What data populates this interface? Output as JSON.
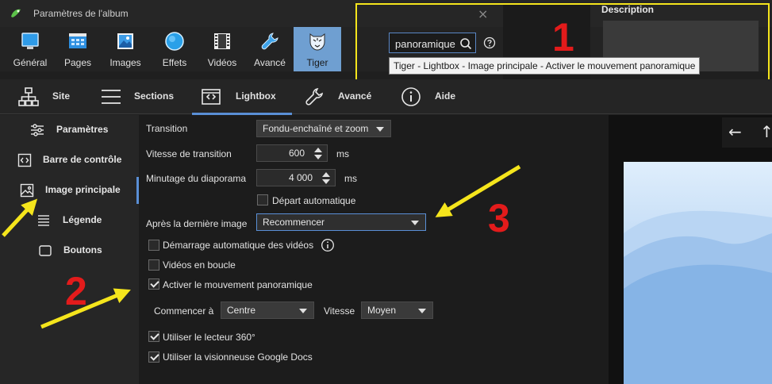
{
  "window": {
    "title": "Paramètres de l'album",
    "close_glyph": "×"
  },
  "toolbar": [
    {
      "label": "Général",
      "icon": "monitor-icon"
    },
    {
      "label": "Pages",
      "icon": "grid-icon"
    },
    {
      "label": "Images",
      "icon": "image-icon"
    },
    {
      "label": "Effets",
      "icon": "effects-icon"
    },
    {
      "label": "Vidéos",
      "icon": "film-icon"
    },
    {
      "label": "Avancé",
      "icon": "wrench-icon"
    },
    {
      "label": "Tiger",
      "icon": "tiger-icon",
      "active": true
    }
  ],
  "search": {
    "value": "panoramique",
    "tooltip": "Tiger - Lightbox - Image principale - Activer le mouvement panoramique"
  },
  "description": {
    "label": "Description"
  },
  "tabs": [
    {
      "label": "Site",
      "icon": "sitemap-icon"
    },
    {
      "label": "Sections",
      "icon": "lines-icon"
    },
    {
      "label": "Lightbox",
      "icon": "lightbox-icon",
      "active": true
    },
    {
      "label": "Avancé",
      "icon": "wrench-icon"
    },
    {
      "label": "Aide",
      "icon": "info-icon"
    }
  ],
  "nav": [
    {
      "label": "Paramètres",
      "icon": "sliders-icon"
    },
    {
      "label": "Barre de contrôle",
      "icon": "code-icon"
    },
    {
      "label": "Image principale",
      "icon": "image-icon",
      "active": true
    },
    {
      "label": "Légende",
      "icon": "lines-icon"
    },
    {
      "label": "Boutons",
      "icon": "button-icon"
    }
  ],
  "settings": {
    "transition_label": "Transition",
    "transition_value": "Fondu-enchaîné et zoom",
    "speed_label": "Vitesse de transition",
    "speed_value": "600",
    "speed_unit": "ms",
    "timer_label": "Minutage du diaporama",
    "timer_value": "4 000",
    "timer_unit": "ms",
    "autostart_label": "Départ automatique",
    "autostart_checked": false,
    "after_label": "Après la dernière image",
    "after_value": "Recommencer",
    "auto_video_label": "Démarrage automatique des vidéos",
    "auto_video_checked": false,
    "loop_label": "Vidéos en boucle",
    "loop_checked": false,
    "pan_label": "Activer le mouvement panoramique",
    "pan_checked": true,
    "start_label": "Commencer à",
    "start_value": "Centre",
    "pan_speed_label": "Vitesse",
    "pan_speed_value": "Moyen",
    "reader360_label": "Utiliser le lecteur 360°",
    "reader360_checked": true,
    "gdocs_label": "Utiliser la visionneuse Google Docs",
    "gdocs_checked": true
  },
  "preview": {
    "back_glyph": "←",
    "up_glyph": "↑"
  },
  "annotations": {
    "n1": "1",
    "n2": "2",
    "n3": "3",
    "highlight_color": "#f5e51c",
    "number_color": "#e31b1b"
  }
}
